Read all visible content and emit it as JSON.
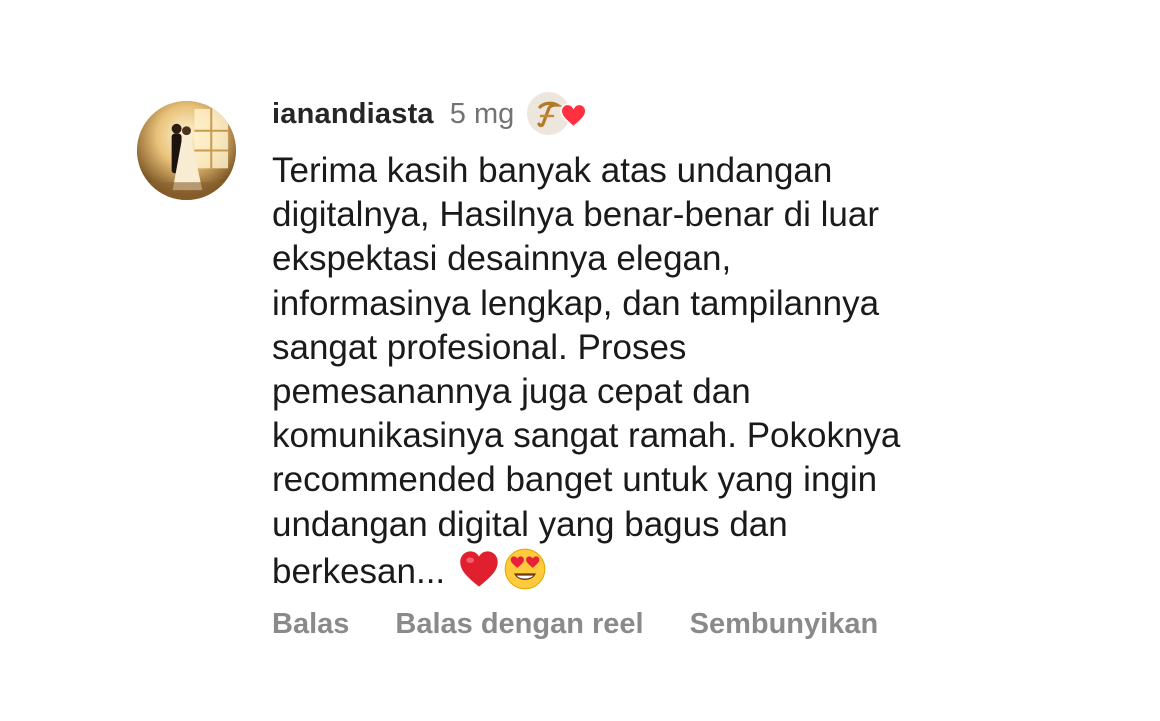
{
  "comment": {
    "avatar_icon": "profile-photo-icon",
    "username": "ianandiasta",
    "timestamp": "5 mg",
    "author_like_badge_icon": "creator-liked-heart-icon",
    "author_like_color": "#ff3040",
    "body_lines": [
      "Terima kasih banyak atas undangan",
      "digitalnya, Hasilnya benar-benar di luar",
      "ekspektasi desainnya elegan,",
      "informasinya lengkap, dan tampilannya",
      "sangat profesional. Proses",
      "pemesanannya juga cepat dan",
      "komunikasinya sangat ramah. Pokoknya",
      "recommended banget untuk yang ingin",
      "undangan digital yang bagus dan",
      "berkesan..."
    ],
    "trailing_emojis": [
      "red-heart-emoji",
      "heart-eyes-emoji"
    ]
  },
  "actions": {
    "reply": "Balas",
    "reply_reel": "Balas dengan reel",
    "hide": "Sembunyikan"
  }
}
